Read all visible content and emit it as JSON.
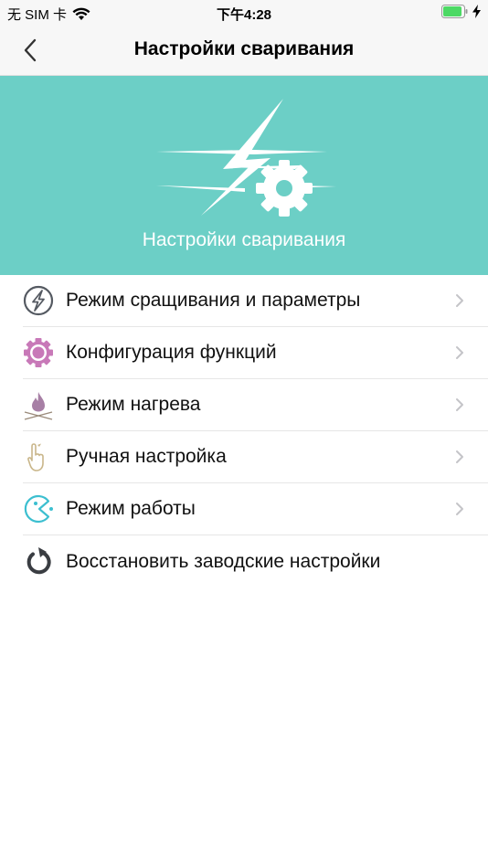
{
  "status_bar": {
    "carrier": "无 SIM 卡",
    "time": "下午4:28"
  },
  "nav": {
    "title": "Настройки сваривания"
  },
  "banner": {
    "title": "Настройки сваривания"
  },
  "menu": {
    "items": [
      {
        "label": "Режим сращивания и параметры",
        "icon": "lightning-circle-icon"
      },
      {
        "label": "Конфигурация функций",
        "icon": "gear-icon"
      },
      {
        "label": "Режим нагрева",
        "icon": "flame-icon"
      },
      {
        "label": "Ручная настройка",
        "icon": "hand-pointer-icon"
      },
      {
        "label": "Режим работы",
        "icon": "pacman-icon"
      },
      {
        "label": "Восстановить заводские настройки",
        "icon": "restore-icon"
      }
    ]
  },
  "colors": {
    "banner": "#6ccfc6",
    "gear": "#c879b8",
    "flame": "#a77fa5",
    "hand": "#c9b68a",
    "mode": "#3cbfd0"
  }
}
